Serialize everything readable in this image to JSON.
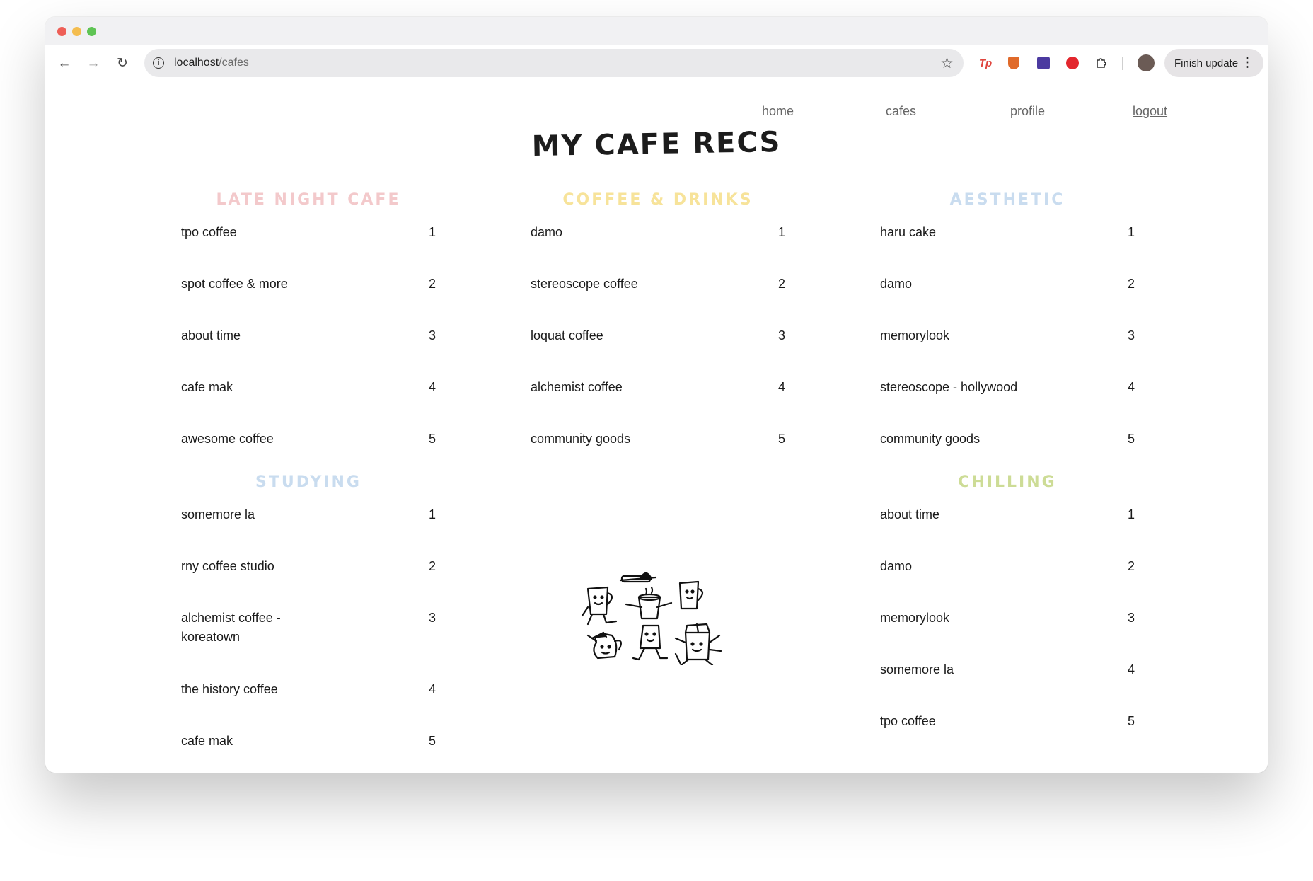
{
  "browser": {
    "url_host": "localhost",
    "url_path": "/cafes",
    "finish_update_label": "Finish update",
    "extension_tp_label": "Tp"
  },
  "nav": {
    "home": "home",
    "cafes": "cafes",
    "profile": "profile",
    "logout": "logout"
  },
  "site_title": "MY CAFE RECS",
  "sections": {
    "late_night": {
      "title": "LATE NIGHT CAFE",
      "color": "#f3c9cb",
      "items": [
        {
          "name": "tpo coffee",
          "rank": "1"
        },
        {
          "name": "spot coffee & more",
          "rank": "2"
        },
        {
          "name": "about time",
          "rank": "3"
        },
        {
          "name": "cafe mak",
          "rank": "4"
        },
        {
          "name": "awesome coffee",
          "rank": "5"
        }
      ]
    },
    "coffee_drinks": {
      "title": "COFFEE & DRINKS",
      "color": "#f7e39a",
      "items": [
        {
          "name": "damo",
          "rank": "1"
        },
        {
          "name": "stereoscope coffee",
          "rank": "2"
        },
        {
          "name": "loquat coffee",
          "rank": "3"
        },
        {
          "name": "alchemist coffee",
          "rank": "4"
        },
        {
          "name": "community goods",
          "rank": "5"
        }
      ]
    },
    "aesthetic": {
      "title": "AESTHETIC",
      "color": "#c9dcef",
      "items": [
        {
          "name": "haru cake",
          "rank": "1"
        },
        {
          "name": "damo",
          "rank": "2"
        },
        {
          "name": "memorylook",
          "rank": "3"
        },
        {
          "name": "stereoscope - hollywood",
          "rank": "4"
        },
        {
          "name": "community goods",
          "rank": "5"
        }
      ]
    },
    "studying": {
      "title": "STUDYING",
      "color": "#c9dcef",
      "items": [
        {
          "name": "somemore la",
          "rank": "1"
        },
        {
          "name": "rny coffee studio",
          "rank": "2"
        },
        {
          "name": "alchemist coffee - koreatown",
          "rank": "3"
        },
        {
          "name": "the history coffee",
          "rank": "4"
        },
        {
          "name": "cafe mak",
          "rank": "5"
        }
      ]
    },
    "chilling": {
      "title": "CHILLING",
      "color": "#cddc96",
      "items": [
        {
          "name": "about time",
          "rank": "1"
        },
        {
          "name": "damo",
          "rank": "2"
        },
        {
          "name": "memorylook",
          "rank": "3"
        },
        {
          "name": "somemore la",
          "rank": "4"
        },
        {
          "name": "tpo coffee",
          "rank": "5"
        }
      ]
    }
  },
  "illustration": {
    "icon": "coffee-characters-illustration"
  }
}
